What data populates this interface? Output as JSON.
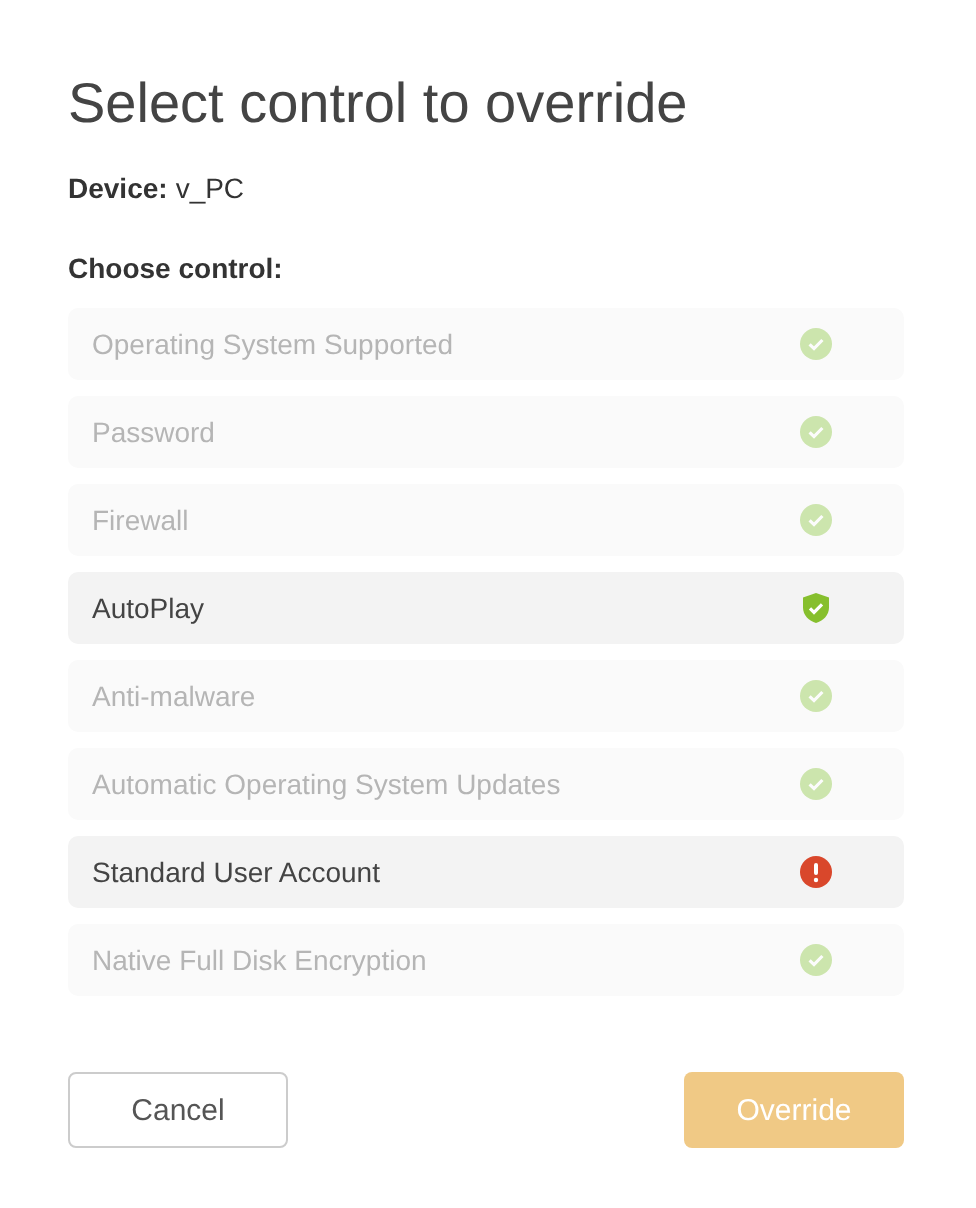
{
  "title": "Select control to override",
  "device": {
    "label": "Device:",
    "value": "v_PC"
  },
  "choose_label": "Choose control:",
  "controls": [
    {
      "name": "Operating System Supported",
      "disabled": true,
      "kind": "pass"
    },
    {
      "name": "Password",
      "disabled": true,
      "kind": "pass"
    },
    {
      "name": "Firewall",
      "disabled": true,
      "kind": "pass"
    },
    {
      "name": "AutoPlay",
      "disabled": false,
      "kind": "shield"
    },
    {
      "name": "Anti-malware",
      "disabled": true,
      "kind": "pass"
    },
    {
      "name": "Automatic Operating System Updates",
      "disabled": true,
      "kind": "pass"
    },
    {
      "name": "Standard User Account",
      "disabled": false,
      "kind": "fail"
    },
    {
      "name": "Native Full Disk Encryption",
      "disabled": true,
      "kind": "pass"
    }
  ],
  "buttons": {
    "cancel": {
      "label": "Cancel"
    },
    "override": {
      "label": "Override",
      "disabled": true
    }
  }
}
